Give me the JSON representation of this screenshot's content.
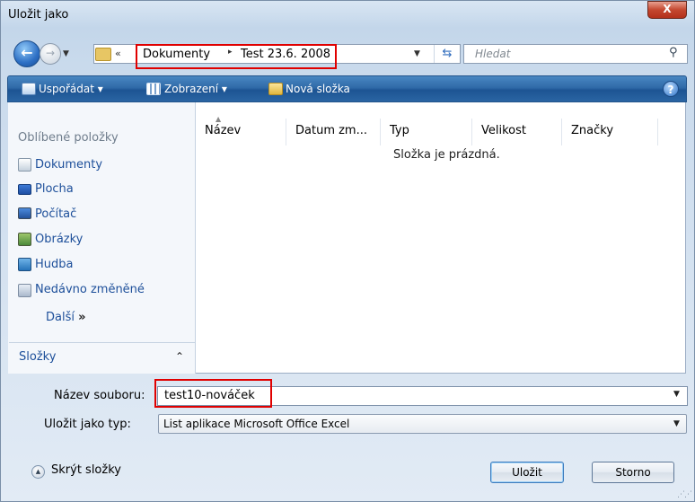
{
  "window": {
    "title": "Uložit jako",
    "close": "X"
  },
  "address": {
    "chevron": "«",
    "segments": [
      "Dokumenty",
      "Test 23.6. 2008"
    ],
    "separator": "▸",
    "search_placeholder": "Hledat"
  },
  "toolbar": {
    "organize": "Uspořádat",
    "views": "Zobrazení",
    "new_folder": "Nová složka",
    "help": "?"
  },
  "sidebar": {
    "favorites_header": "Oblíbené položky",
    "items": [
      {
        "label": "Dokumenty",
        "icon": "documents-icon"
      },
      {
        "label": "Plocha",
        "icon": "desktop-icon"
      },
      {
        "label": "Počítač",
        "icon": "computer-icon"
      },
      {
        "label": "Obrázky",
        "icon": "pictures-icon"
      },
      {
        "label": "Hudba",
        "icon": "music-icon"
      },
      {
        "label": "Nedávno změněné",
        "icon": "recent-icon"
      }
    ],
    "more": "Další",
    "more_arrows": "»",
    "folders_label": "Složky"
  },
  "filelist": {
    "columns": [
      "Název",
      "Datum zm...",
      "Typ",
      "Velikost",
      "Značky"
    ],
    "empty_message": "Složka je prázdná."
  },
  "form": {
    "filename_label": "Název souboru:",
    "filename_value": "test10-nováček",
    "filetype_label": "Uložit jako typ:",
    "filetype_value": "List aplikace Microsoft Office Excel"
  },
  "footer": {
    "hide_folders": "Skrýt složky",
    "save": "Uložit",
    "cancel": "Storno"
  },
  "colors": {
    "highlight_box": "#e00000",
    "toolbar": "#2f6aa8",
    "link": "#1d4f9a"
  }
}
